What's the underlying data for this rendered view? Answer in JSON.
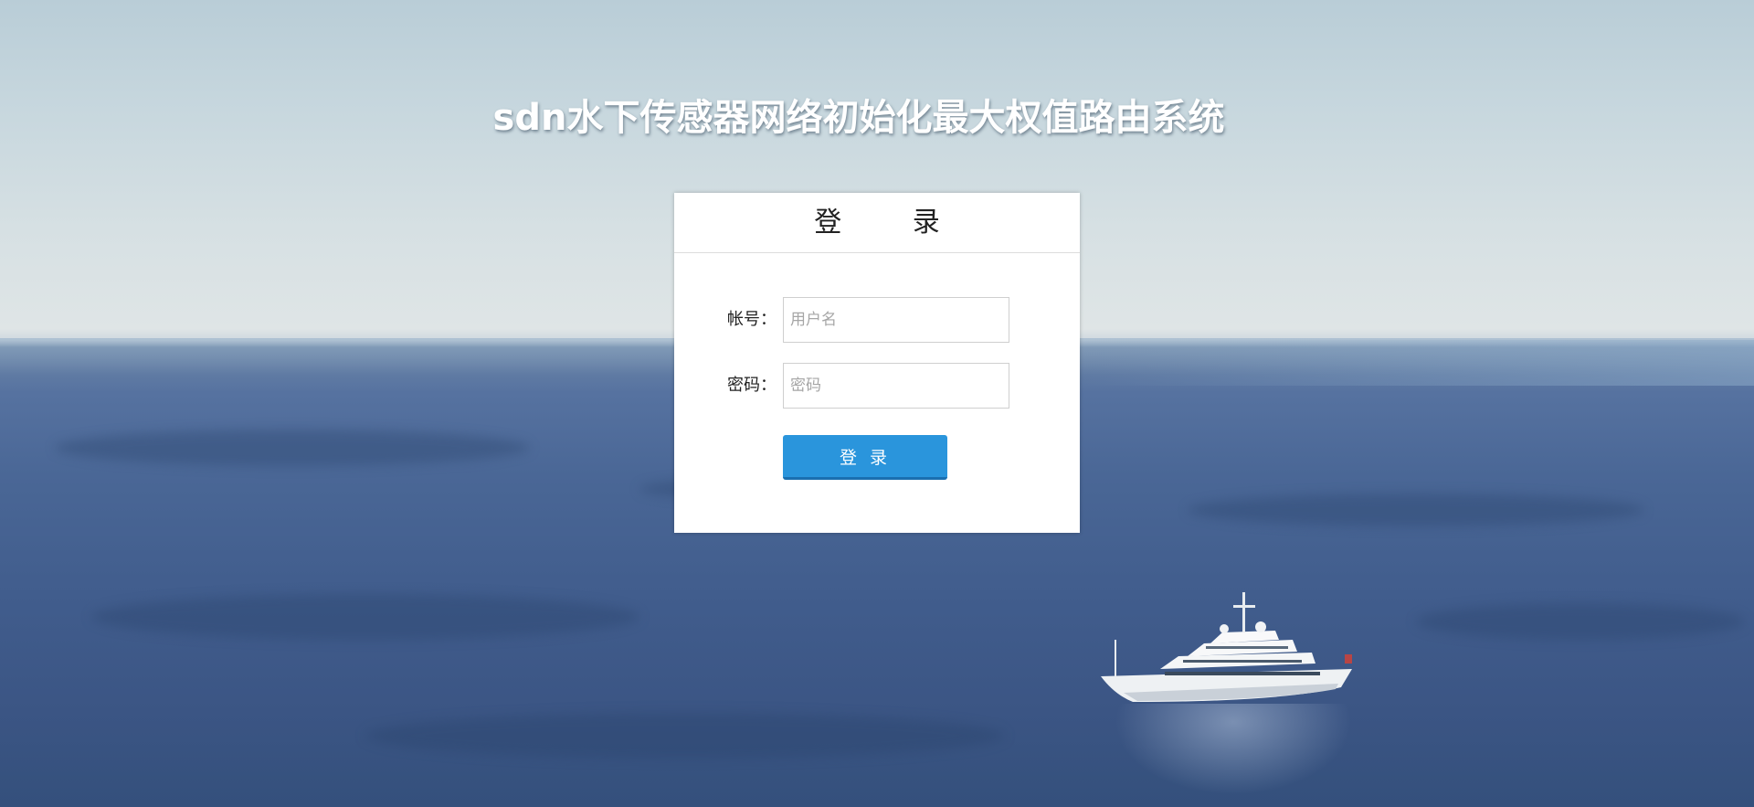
{
  "page": {
    "title": "sdn水下传感器网络初始化最大权值路由系统"
  },
  "login": {
    "header": "登 录",
    "account_label": "帐号：",
    "account_placeholder": "用户名",
    "account_value": "",
    "password_label": "密码：",
    "password_placeholder": "密码",
    "password_value": "",
    "submit_label": "登 录"
  },
  "colors": {
    "button": "#2a95dc",
    "button_border": "#1a6fb0",
    "card_bg": "#ffffff",
    "title_text": "#ffffff"
  }
}
